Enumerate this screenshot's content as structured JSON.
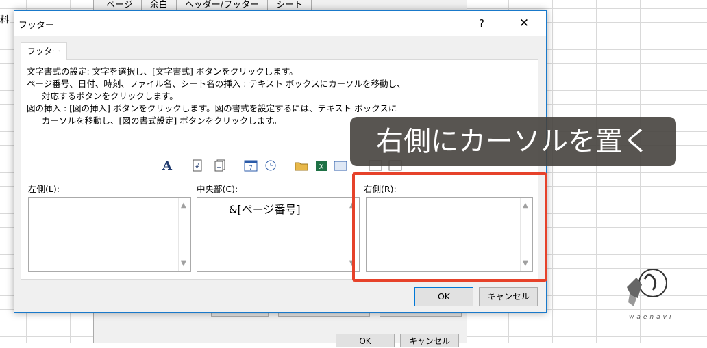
{
  "background": {
    "cell_text": "料",
    "tabs": [
      "ページ",
      "余白",
      "ヘッダー/フッター",
      "シート"
    ],
    "ok_label": "OK",
    "cancel_label": "キャンセル"
  },
  "dialog": {
    "title": "フッター",
    "help_label": "?",
    "close_label": "✕",
    "tab_label": "フッター",
    "instructions": {
      "line1": "文字書式の設定: 文字を選択し、[文字書式] ボタンをクリックします。",
      "line2": "ページ番号、日付、時刻、ファイル名、シート名の挿入 : テキスト ボックスにカーソルを移動し、",
      "line3": "対応するボタンをクリックします。",
      "line4": "図の挿入 : [図の挿入] ボタンをクリックします。図の書式を設定するには、テキスト ボックスに",
      "line5": "カーソルを移動し、[図の書式設定] ボタンをクリックします。"
    },
    "toolbar": {
      "format_text": "A"
    },
    "left": {
      "label": "左側(",
      "key": "L",
      "close": "):",
      "value": ""
    },
    "center": {
      "label": "中央部(",
      "key": "C",
      "close": "):",
      "value": "&[ページ番号]"
    },
    "right": {
      "label": "右側(",
      "key": "R",
      "close": "):",
      "value": ""
    },
    "ok_label": "OK",
    "cancel_label": "キャンセル"
  },
  "annotation": {
    "callout": "右側にカーソルを置く",
    "highlight_color": "#e6422a"
  },
  "logo": {
    "text": "waenavi"
  }
}
